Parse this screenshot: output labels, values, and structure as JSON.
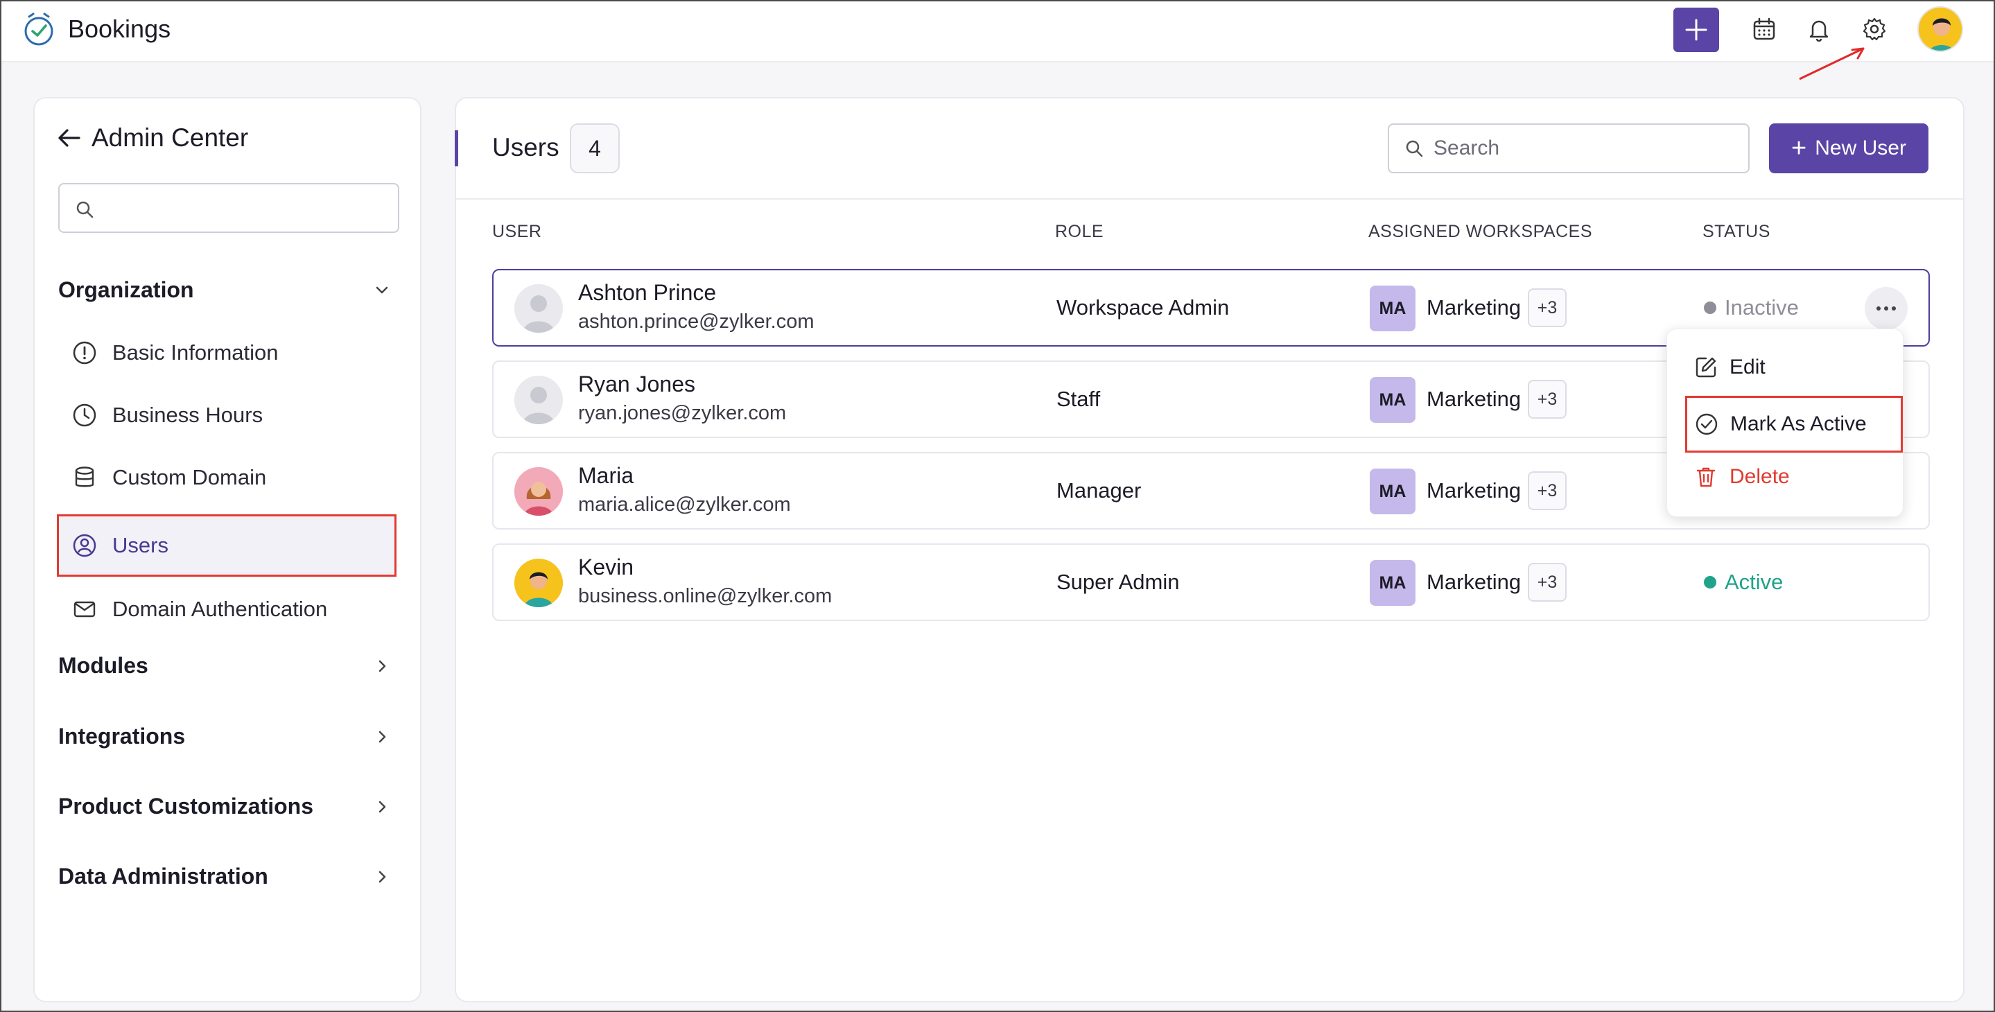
{
  "app": {
    "name": "Bookings"
  },
  "topbar": {
    "add_icon": "plus-icon",
    "calendar_icon": "calendar-icon",
    "notification_icon": "bell-icon",
    "settings_icon": "gear-icon",
    "profile_icon": "avatar"
  },
  "sidebar": {
    "title": "Admin Center",
    "search_placeholder": "",
    "sections": [
      {
        "label": "Organization",
        "expanded": true
      },
      {
        "label": "Modules",
        "expanded": false
      },
      {
        "label": "Integrations",
        "expanded": false
      },
      {
        "label": "Product Customizations",
        "expanded": false
      },
      {
        "label": "Data Administration",
        "expanded": false
      }
    ],
    "organization_items": [
      {
        "label": "Basic Information",
        "icon": "info-icon"
      },
      {
        "label": "Business Hours",
        "icon": "clock-icon"
      },
      {
        "label": "Custom Domain",
        "icon": "database-icon"
      },
      {
        "label": "Users",
        "icon": "user-circle-icon",
        "active": true
      },
      {
        "label": "Domain Authentication",
        "icon": "mail-icon"
      }
    ]
  },
  "main": {
    "title": "Users",
    "count": "4",
    "search_placeholder": "Search",
    "new_user_label": "New User",
    "columns": [
      "USER",
      "ROLE",
      "ASSIGNED WORKSPACES",
      "STATUS"
    ],
    "users": [
      {
        "name": "Ashton Prince",
        "email": "ashton.prince@zylker.com",
        "role": "Workspace Admin",
        "workspace_badge": "MA",
        "workspace": "Marketing",
        "more": "+3",
        "status": "Inactive"
      },
      {
        "name": "Ryan Jones",
        "email": "ryan.jones@zylker.com",
        "role": "Staff",
        "workspace_badge": "MA",
        "workspace": "Marketing",
        "more": "+3",
        "status": ""
      },
      {
        "name": "Maria",
        "email": "maria.alice@zylker.com",
        "role": "Manager",
        "workspace_badge": "MA",
        "workspace": "Marketing",
        "more": "+3",
        "status": ""
      },
      {
        "name": "Kevin",
        "email": "business.online@zylker.com",
        "role": "Super Admin",
        "workspace_badge": "MA",
        "workspace": "Marketing",
        "more": "+3",
        "status": "Active"
      }
    ],
    "row_menu": {
      "items": [
        {
          "label": "Edit",
          "icon": "edit-icon"
        },
        {
          "label": "Mark As Active",
          "icon": "check-circle-icon"
        },
        {
          "label": "Delete",
          "icon": "trash-icon"
        }
      ]
    }
  },
  "colors": {
    "accent": "#5a44a6",
    "active_status": "#1fa38a",
    "inactive_status": "#8e8e98",
    "danger": "#e03a2f",
    "highlight_border": "#e23a32"
  }
}
